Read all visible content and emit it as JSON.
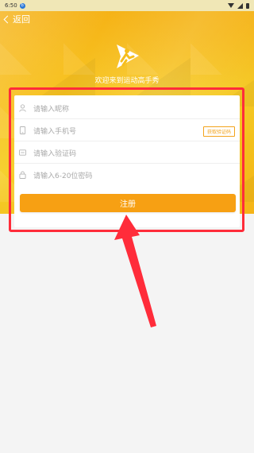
{
  "status_bar": {
    "time": "6:50",
    "notification_badge": "b"
  },
  "header": {
    "back_label": "返回",
    "welcome_text": "欢迎来到运动高手秀",
    "colors": {
      "primary": "#f6be1d",
      "accent": "#f7a013"
    }
  },
  "form": {
    "nickname_placeholder": "请输入昵称",
    "phone_placeholder": "请输入手机号",
    "get_code_label": "获取验证码",
    "code_placeholder": "请输入验证码",
    "password_placeholder": "请输入6-20位密码",
    "register_label": "注册"
  },
  "icons": {
    "nickname": "user-icon",
    "phone": "phone-icon",
    "code": "sms-code-icon",
    "password": "lock-icon"
  },
  "annotation": {
    "highlight_color": "#ff2c3a"
  }
}
